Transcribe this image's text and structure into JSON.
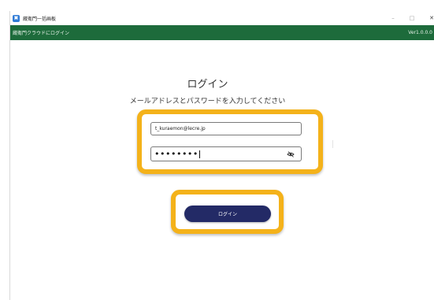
{
  "window": {
    "title": "蔵衛門一括画板",
    "icon": "app-icon"
  },
  "header": {
    "title": "蔵衛門クラウドにログイン",
    "version": "Ver1.0.0.0"
  },
  "controls": {
    "minimize": "–",
    "maximize": "□",
    "close": "✕"
  },
  "login": {
    "title": "ログイン",
    "subtitle": "メールアドレスとパスワードを入力してください",
    "email_value": "t_kuraemon@lecre.jp",
    "password_masked": "••••••••",
    "button_label": "ログイン"
  },
  "colors": {
    "header_bg": "#1d6b3b",
    "highlight": "#f4b21a",
    "button_bg": "#232a66"
  }
}
